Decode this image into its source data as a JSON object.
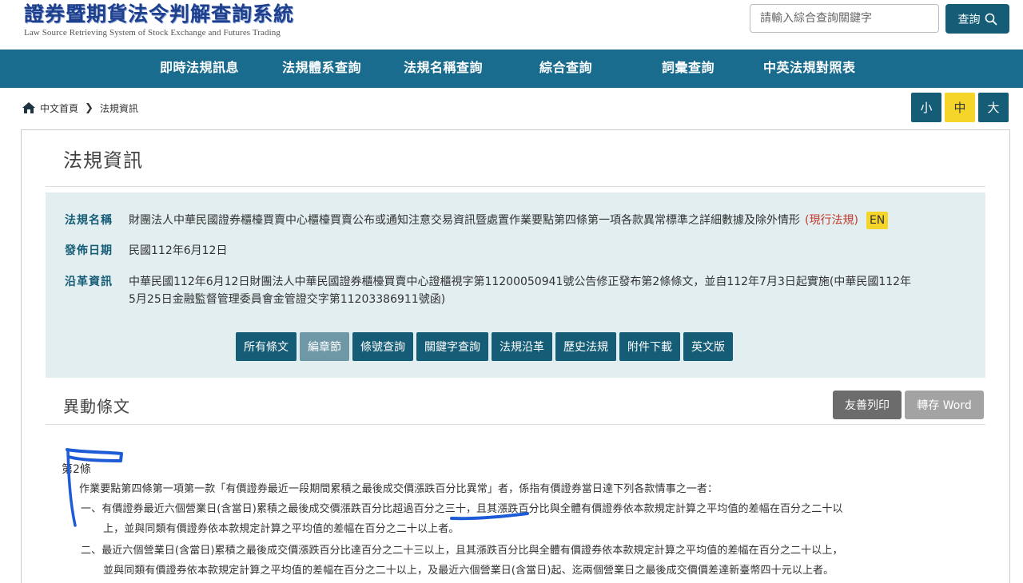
{
  "header": {
    "logo_zh": "證券暨期貨法令判解查詢系統",
    "logo_en": "Law Source Retrieving System of Stock Exchange and Futures Trading",
    "search_placeholder": "請輸入綜合查詢關鍵字",
    "search_button": "查詢"
  },
  "nav": {
    "items": [
      "即時法規訊息",
      "法規體系查詢",
      "法規名稱查詢",
      "綜合查詢",
      "詞彙查詢",
      "中英法規對照表"
    ]
  },
  "breadcrumb": {
    "home": "中文首頁",
    "current": "法規資訊"
  },
  "font_size": {
    "small": "小",
    "medium": "中",
    "large": "大",
    "selected": "中"
  },
  "page": {
    "title": "法規資訊"
  },
  "info": {
    "name_label": "法規名稱",
    "name_value": "財團法人中華民國證券櫃檯買賣中心櫃檯買賣公布或通知注意交易資訊暨處置作業要點第四條第一項各款異常標準之詳細數據及除外情形",
    "status": "(現行法規)",
    "en_tag": "EN",
    "date_label": "發佈日期",
    "date_value": "民國112年6月12日",
    "history_label": "沿革資訊",
    "history_line1": "中華民國112年6月12日財團法人中華民國證券櫃檯買賣中心證櫃視字第11200050941號公告修正發布第2條條文，並自112年7月3日起實施(中華民國112年",
    "history_line2": "5月25日金融監督管理委員會金管證交字第11203386911號函)"
  },
  "actions": {
    "buttons": [
      "所有條文",
      "編章節",
      "條號查詢",
      "關鍵字查詢",
      "法規沿革",
      "歷史法規",
      "附件下載",
      "英文版"
    ],
    "active": "編章節"
  },
  "changes": {
    "title": "異動條文",
    "print_button": "友善列印",
    "word_button": "轉存 Word"
  },
  "article": {
    "number": "第2條",
    "intro": "作業要點第四條第一項第一款「有價證券最近一段期間累積之最後成交價漲跌百分比異常」者，係指有價證券當日達下列各款情事之一者：",
    "item1_line1": "一、有價證券最近六個營業日(含當日)累積之最後成交價漲跌百分比超過百分之三十，且其漲跌百分比與全體有價證券依本款規定計算之平均值的差幅在百分之二十以",
    "item1_line2": "上，並與同類有價證券依本款規定計算之平均值的差幅在百分之二十以上者。",
    "item2_line1": "二、最近六個營業日(含當日)累積之最後成交價漲跌百分比達百分之二十三以上，且其漲跌百分比與全體有價證券依本款規定計算之平均值的差幅在百分之二十以上，",
    "item2_line2": "並與同類有價證券依本款規定計算之平均值的差幅在百分之二十以上，及最近六個營業日(含當日)起、迄兩個營業日之最後成交價價差達新臺幣四十元以上者。"
  },
  "colors": {
    "brand": "#1a6c8f",
    "button": "#155c77",
    "highlight": "#f6d52a",
    "status_red": "#c0392b",
    "annotation_blue": "#1e5bd6"
  }
}
